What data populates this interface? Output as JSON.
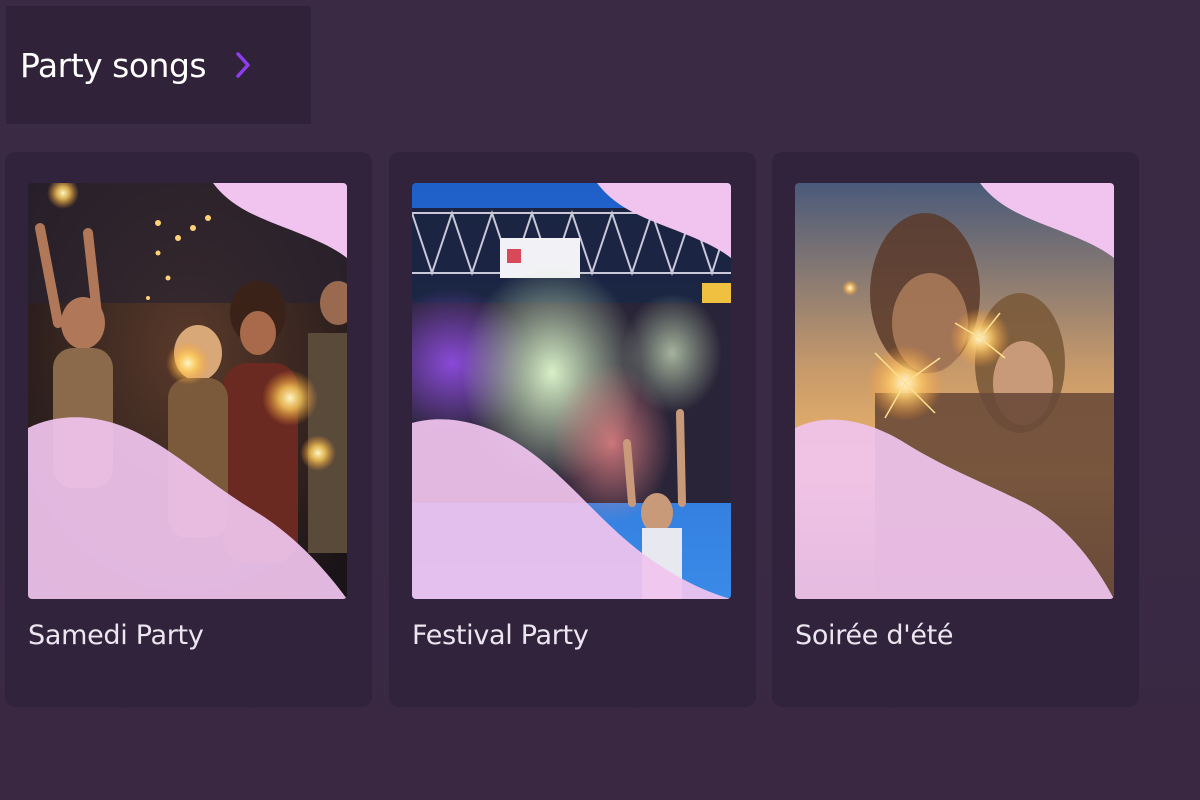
{
  "section": {
    "title": "Party songs",
    "chevron_icon": "chevron-right-icon",
    "accent": "#8f3df0"
  },
  "playlists": [
    {
      "title": "Samedi Party",
      "image": "friends-with-sparklers-night"
    },
    {
      "title": "Festival Party",
      "image": "color-powder-festival-stage"
    },
    {
      "title": "Soirée d'été",
      "image": "couple-with-sparklers-sunset"
    }
  ],
  "colors": {
    "background": "#3a2a44",
    "header_bg": "#2f2239",
    "card_bg": "#32233c",
    "wave_overlay": "#f0c4ee"
  }
}
